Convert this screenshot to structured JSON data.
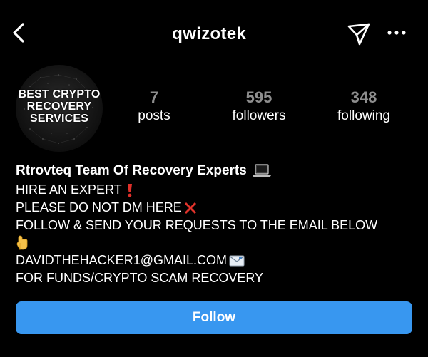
{
  "header": {
    "username": "qwizotek_",
    "back_icon": "chevron-left-icon",
    "send_icon": "paper-plane-icon",
    "more_icon": "ellipsis-icon"
  },
  "profile": {
    "avatar_text": [
      "BEST CRYPTO",
      "RECOVERY",
      "SERVICES"
    ],
    "stats": [
      {
        "value": "7",
        "label": "posts"
      },
      {
        "value": "595",
        "label": "followers"
      },
      {
        "value": "348",
        "label": "following"
      }
    ]
  },
  "bio": {
    "name": "Rtrovteq Team Of Recovery Experts",
    "name_emoji": "laptop-icon",
    "lines": [
      {
        "text": "HIRE AN EXPERT",
        "emoji": "exclamation-icon"
      },
      {
        "text": "PLEASE DO NOT DM HERE",
        "emoji": "cross-mark-icon"
      },
      {
        "text": "FOLLOW & SEND YOUR REQUESTS TO THE EMAIL BELOW",
        "emoji": ""
      },
      {
        "text": "",
        "emoji": "pointing-down-icon"
      },
      {
        "text": "DAVIDTHEHACKER1@GMAIL.COM",
        "emoji": "envelope-icon"
      },
      {
        "text": "FOR FUNDS/CRYPTO SCAM RECOVERY",
        "emoji": ""
      }
    ]
  },
  "actions": {
    "follow_label": "Follow"
  },
  "colors": {
    "background": "#000000",
    "follow_button": "#3897f0",
    "stat_number": "#8e8e8e",
    "text": "#ffffff"
  }
}
